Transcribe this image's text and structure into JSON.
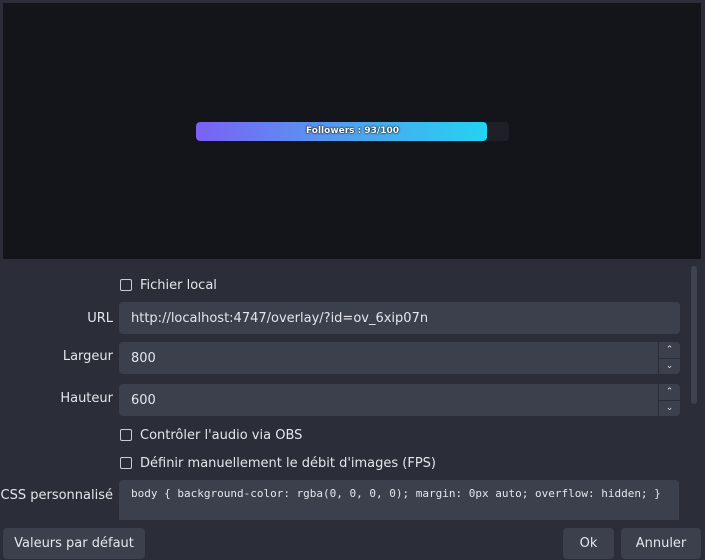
{
  "preview": {
    "progress_label": "Followers : 93/100",
    "progress_fraction": 0.93
  },
  "settings": {
    "local_file_label": "Fichier local",
    "url_label": "URL",
    "url_value": "http://localhost:4747/overlay/?id=ov_6xip07n",
    "width_label": "Largeur",
    "width_value": "800",
    "height_label": "Hauteur",
    "height_value": "600",
    "audio_label": "Contrôler l'audio via OBS",
    "fps_label": "Définir manuellement le débit d'images (FPS)",
    "css_label": "CSS personnalisé",
    "css_value": "body { background-color: rgba(0, 0, 0, 0); margin: 0px auto; overflow: hidden; }"
  },
  "footer": {
    "defaults_label": "Valeurs par défaut",
    "ok_label": "Ok",
    "cancel_label": "Annuler"
  },
  "colors": {
    "dialog_bg": "#2b2e38",
    "preview_bg": "#14151b",
    "input_bg": "#3c404d",
    "gradient_start": "#7b61f5",
    "gradient_end": "#23d3f2"
  }
}
